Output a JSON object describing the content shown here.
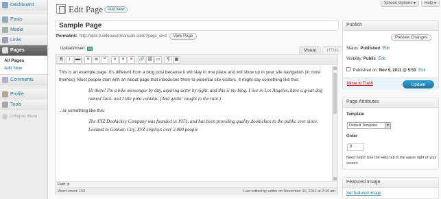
{
  "topbar": {
    "screen_options": "Screen Options ▾",
    "help": "Help ▾"
  },
  "menu": {
    "dashboard": "Dashboard",
    "posts": "Posts",
    "media": "Media",
    "links": "Links",
    "pages": "Pages",
    "pages_sub": [
      "All Pages",
      "Add New"
    ],
    "comments": "Comments",
    "profile": "Profile",
    "tools": "Tools",
    "collapse": "Collapse menu"
  },
  "header": {
    "title": "Edit Page",
    "add_new": "Add New"
  },
  "post": {
    "title": "Sample Page",
    "permalink_label": "Permalink:",
    "permalink_url": "http://wp3-3.videousermanuals.com/?page_id=2",
    "view_page": "View Page"
  },
  "editor": {
    "upload_insert": "Upload/Insert",
    "tab_visual": "Visual",
    "tab_html": "HTML",
    "toolbar": [
      "B",
      "I",
      "abc",
      "≡",
      "≣",
      "❝",
      "≡",
      "≡",
      "≡",
      "🔗",
      "⛓",
      "▭",
      "¶",
      "▦"
    ],
    "paragraph1": "This is an example page. It's different from a blog post because it will stay in one place and will show up in your site navigation (in most themes). Most people start with an About page that introduces them to potential site visitors. It might say something like this:",
    "quote1": "Hi there! I'm a bike messenger by day, aspiring actor by night, and this is my blog. I live in Los Angeles, have a great dog named Jack, and I like piña coladas. (And gettin' caught in the rain.)",
    "paragraph2": "...or something like this:",
    "quote2": "The XYZ Doohickey Company was founded in 1971, and has been providing quality doohickies to the public ever since. Located in Gotham City, XYZ employs over 2,000 people",
    "path": "Path: p",
    "word_count": "Word count: 153",
    "last_edited": "Last edited by editor on November 10, 2011 at 2:14 am"
  },
  "publish": {
    "heading": "Publish",
    "preview": "Preview Changes",
    "status_label": "Status:",
    "status_value": "Published",
    "visibility_label": "Visibility:",
    "visibility_value": "Public",
    "published_label": "Published on:",
    "published_value": "Nov 9, 2011 @ 5:53",
    "edit": "Edit",
    "trash": "Move to Trash",
    "update": "Update"
  },
  "attributes": {
    "heading": "Page Attributes",
    "template_label": "Template",
    "template_value": "Default Template",
    "order_label": "Order",
    "order_value": "0",
    "help": "Need help? Use the Help tab in the upper right of your screen."
  },
  "featured": {
    "heading": "Featured Image",
    "link": "Set featured image"
  },
  "colors": {
    "accent": "#21759b",
    "update_button": "#2e9fd2",
    "trash": "#bc0b0b",
    "menu_current": "#6d6d6d"
  }
}
